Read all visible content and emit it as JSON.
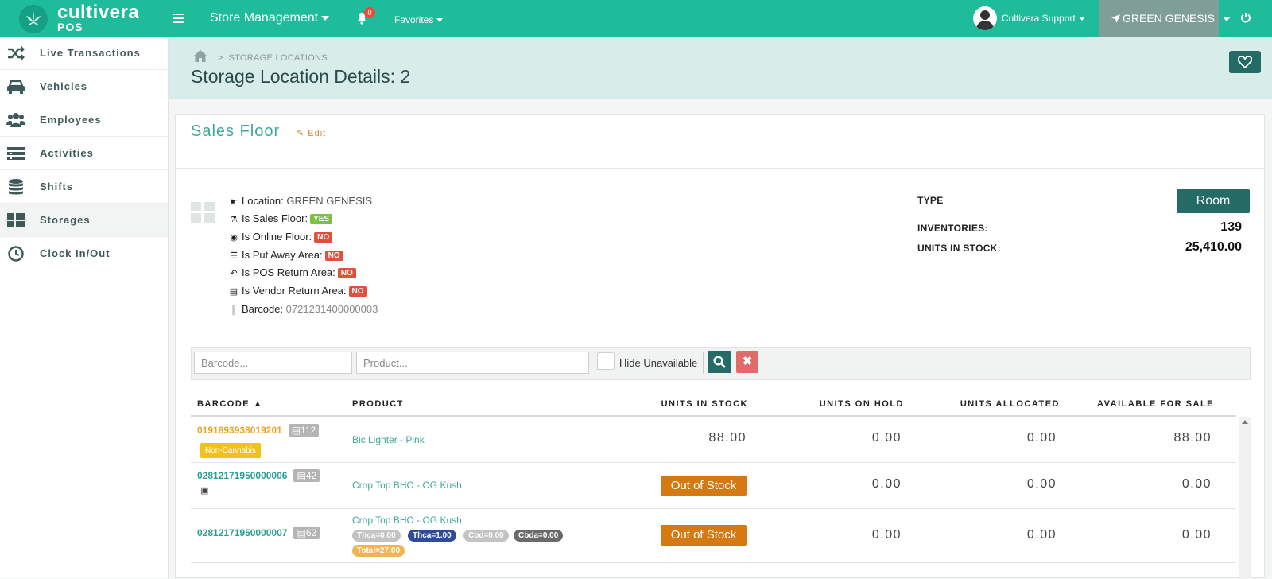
{
  "brand": {
    "name": "cultivera",
    "sub": "POS"
  },
  "topnav": {
    "store_menu": "Store Management",
    "notifications_count": "0",
    "favorites": "Favorites",
    "user": "Cultivera Support",
    "store": "GREEN GENESIS"
  },
  "sidebar": {
    "items": [
      {
        "label": "Live Transactions",
        "icon": "shuffle-icon"
      },
      {
        "label": "Vehicles",
        "icon": "car-icon"
      },
      {
        "label": "Employees",
        "icon": "users-icon"
      },
      {
        "label": "Activities",
        "icon": "list-icon"
      },
      {
        "label": "Shifts",
        "icon": "database-icon"
      },
      {
        "label": "Storages",
        "icon": "grid-icon",
        "active": true
      },
      {
        "label": "Clock In/Out",
        "icon": "clock-icon"
      }
    ]
  },
  "header": {
    "breadcrumb": "STORAGE LOCATIONS",
    "title": "Storage Location Details: 2"
  },
  "location": {
    "name": "Sales Floor",
    "edit_label": "Edit",
    "location_label": "Location:",
    "location_value": "GREEN GENESIS",
    "sales_floor_label": "Is Sales Floor:",
    "sales_floor_value": "YES",
    "online_floor_label": "Is Online Floor:",
    "online_floor_value": "NO",
    "put_away_label": "Is Put Away Area:",
    "put_away_value": "NO",
    "pos_return_label": "Is POS Return Area:",
    "pos_return_value": "NO",
    "vendor_return_label": "Is Vendor Return Area:",
    "vendor_return_value": "NO",
    "barcode_label": "Barcode:",
    "barcode_value": "0721231400000003"
  },
  "stats": {
    "type_label": "TYPE",
    "type_value": "Room",
    "inventories_label": "INVENTORIES:",
    "inventories_value": "139",
    "units_label": "UNITS IN STOCK:",
    "units_value": "25,410.00"
  },
  "filters": {
    "barcode_placeholder": "Barcode...",
    "product_placeholder": "Product...",
    "hide_unavailable": "Hide Unavailable"
  },
  "table": {
    "headers": {
      "barcode": "BARCODE ▲",
      "product": "PRODUCT",
      "units_in_stock": "UNITS IN STOCK",
      "units_on_hold": "UNITS ON HOLD",
      "units_allocated": "UNITS ALLOCATED",
      "available": "AVAILABLE FOR SALE"
    },
    "rows": [
      {
        "barcode": "0191893938019201",
        "qty": "112",
        "tag": "Non-Cannabis",
        "product": "Bic Lighter - Pink",
        "in_stock": "88.00",
        "on_hold": "0.00",
        "allocated": "0.00",
        "available": "88.00"
      },
      {
        "barcode": "02812171950000006",
        "qty": "42",
        "product": "Crop Top BHO - OG Kush",
        "in_stock": "Out of Stock",
        "on_hold": "0.00",
        "allocated": "0.00",
        "available": "0.00"
      },
      {
        "barcode": "02812171950000007",
        "qty": "62",
        "product": "Crop Top BHO - OG Kush",
        "cannabinoids": [
          "Thca=0.00",
          "Thca=1.00",
          "Cbd=0.00",
          "Cbda=0.00",
          "Total=27.00"
        ],
        "in_stock": "Out of Stock",
        "on_hold": "0.00",
        "allocated": "0.00",
        "available": "0.00"
      }
    ]
  },
  "colors": {
    "topbar": "#1fbc9b",
    "accent_dark": "#246a65",
    "header_bg": "#d8ecea",
    "out_of_stock": "#d57912"
  }
}
